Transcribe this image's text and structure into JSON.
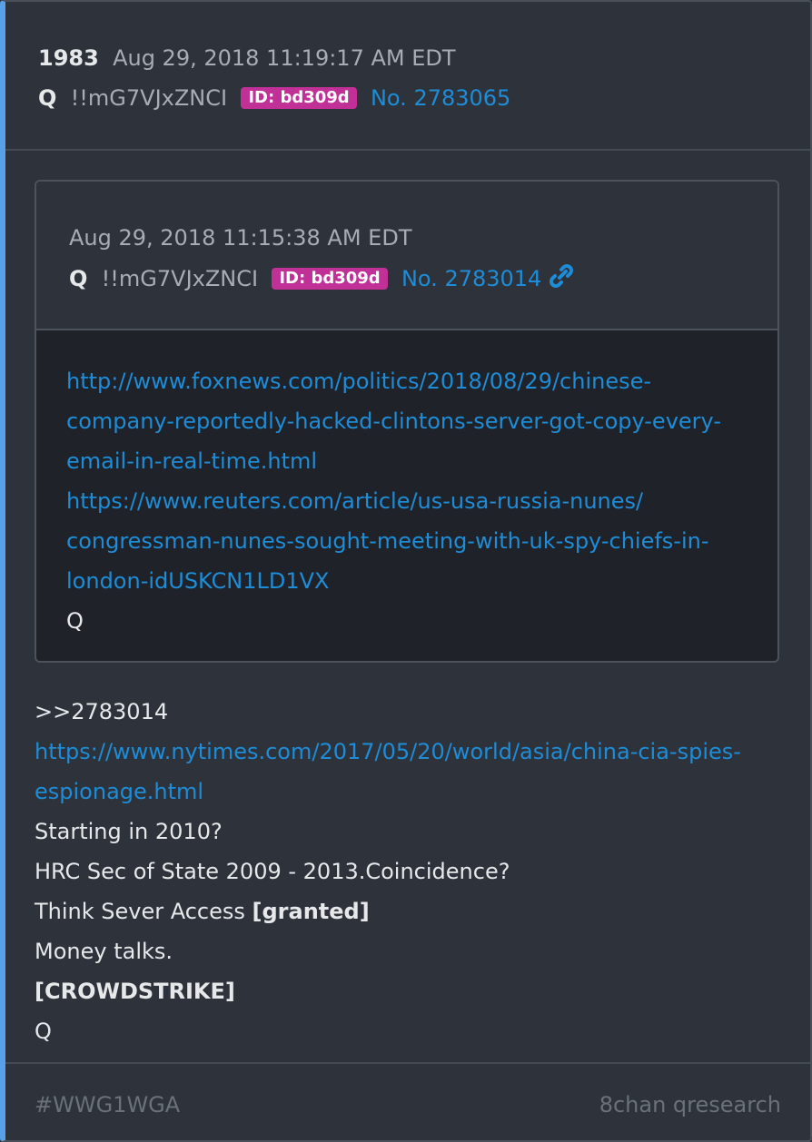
{
  "post": {
    "number": "1983",
    "timestamp": "Aug 29, 2018 11:19:17 AM EDT",
    "author": "Q",
    "tripcode": "!!mG7VJxZNCI",
    "id_badge": "ID: bd309d",
    "post_no": "No. 2783065"
  },
  "quoted": {
    "timestamp": "Aug 29, 2018 11:15:38 AM EDT",
    "author": "Q",
    "tripcode": "!!mG7VJxZNCI",
    "id_badge": "ID: bd309d",
    "post_no": "No. 2783014",
    "link_icon": "link-icon",
    "lines": [
      "http://www.foxnews.com/politics/2018/08/29/chinese-",
      "company-reportedly-hacked-clintons-server-got-copy-every-",
      "email-in-real-time.html",
      "https://www.reuters.com/article/us-usa-russia-nunes/",
      "congressman-nunes-sought-meeting-with-uk-spy-chiefs-in-",
      "london-idUSKCN1LD1VX"
    ],
    "signature": "Q"
  },
  "body": {
    "reply_ref": ">>2783014",
    "link_line1": "https://www.nytimes.com/2017/05/20/world/asia/china-cia-spies-",
    "link_line2": "espionage.html",
    "line3": "Starting in 2010?",
    "line4": "HRC Sec of State 2009 - 2013.Coincidence?",
    "line5_prefix": "Think Sever Access ",
    "line5_bold": "[granted]",
    "line6": "Money talks.",
    "line7": "[CROWDSTRIKE]",
    "signature": "Q"
  },
  "footer": {
    "hashtag": "#WWG1WGA",
    "source": "8chan qresearch"
  },
  "colors": {
    "accent": "#5aa0e6",
    "link": "#1e8cd6",
    "badge": "#c03096",
    "background": "#2d323b",
    "quote_background": "#1f2329"
  }
}
